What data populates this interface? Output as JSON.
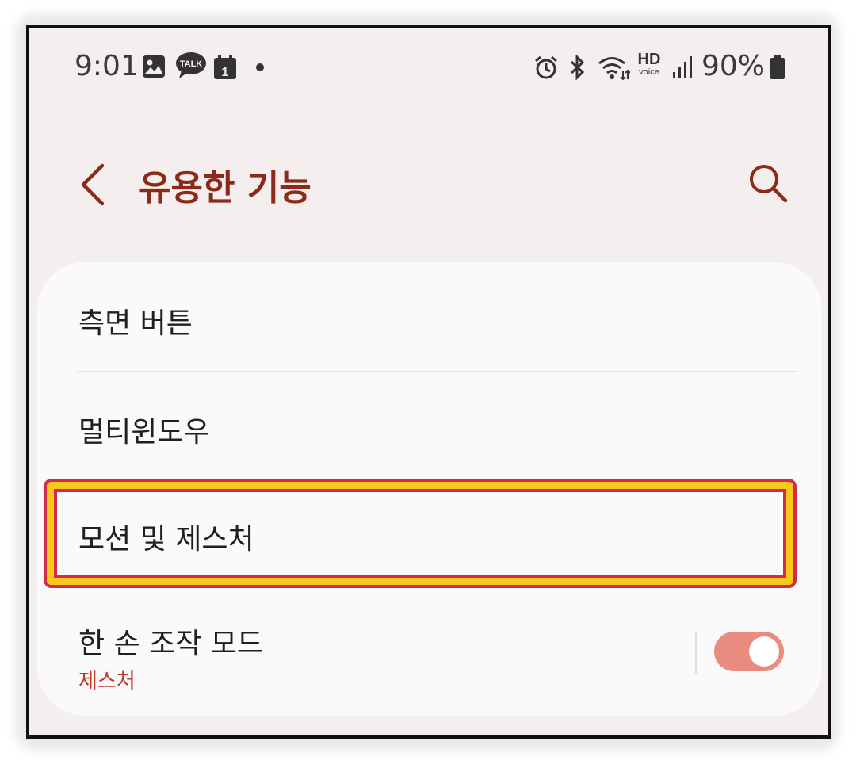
{
  "status_bar": {
    "time": "9:01",
    "left_icons": [
      "gallery-icon",
      "kakaotalk-icon",
      "calendar-icon",
      "dot-icon"
    ],
    "talk_text": "TALK",
    "calendar_day": "1",
    "right_icons": [
      "alarm-icon",
      "bluetooth-icon",
      "wifi-icon",
      "hd-voice-icon",
      "signal-icon",
      "battery-icon"
    ],
    "hd_text": "HD",
    "voice_text": "voice",
    "battery": "90%"
  },
  "header": {
    "title": "유용한 기능",
    "back_icon": "chevron-left-icon",
    "search_icon": "search-icon"
  },
  "menu": {
    "items": [
      {
        "label": "측면 버튼"
      },
      {
        "label": "멀티윈도우"
      },
      {
        "label": "모션 및 제스처",
        "highlighted": true
      },
      {
        "label": "한 손 조작 모드",
        "sublabel": "제스처",
        "toggle": true,
        "toggle_on": true
      }
    ]
  },
  "colors": {
    "accent": "#8b2b17",
    "sublabel": "#c0392b",
    "toggle_on": "#e98b7f",
    "highlight_red": "#d6294a",
    "highlight_yellow": "#f7c81a",
    "background": "#f4efee",
    "card": "#fafafa"
  }
}
